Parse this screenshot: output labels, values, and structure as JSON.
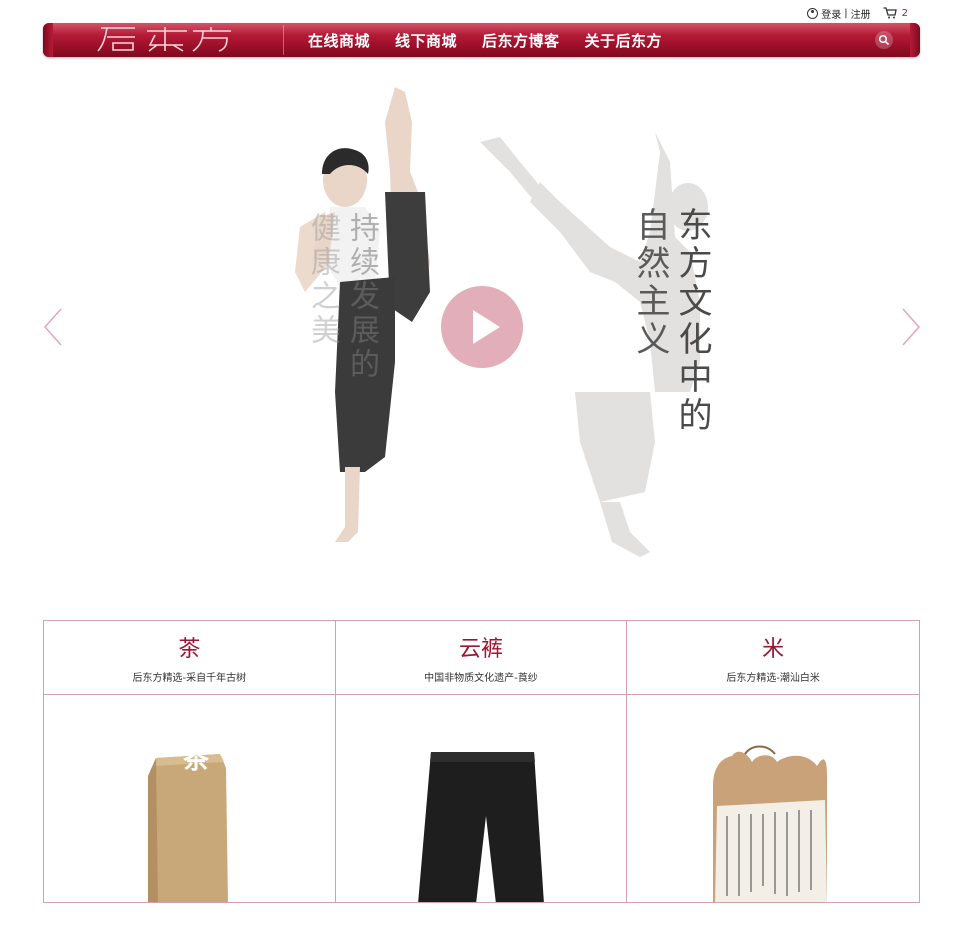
{
  "topbar": {
    "login": "登录",
    "separator": "|",
    "register": "注册",
    "cart_count": "2"
  },
  "nav": {
    "logo_text": "后东方",
    "items": [
      {
        "label": "在线商城"
      },
      {
        "label": "线下商城"
      },
      {
        "label": "后东方博客"
      },
      {
        "label": "关于后东方"
      }
    ]
  },
  "hero": {
    "text_right_1": "东方文化中的",
    "text_right_2": "自然主义",
    "text_left_1": "持续发展的",
    "text_left_2": "健康之美"
  },
  "products": [
    {
      "title": "茶",
      "subtitle": "后东方精选-采自千年古树",
      "package_text": "茶"
    },
    {
      "title": "云裤",
      "subtitle": "中国非物质文化遗产-莨纱"
    },
    {
      "title": "米",
      "subtitle": "后东方精选-潮汕白米"
    }
  ],
  "colors": {
    "brand_red": "#9c1531",
    "border_pink": "#d3a0ae",
    "play_pink": "#c86c80"
  }
}
